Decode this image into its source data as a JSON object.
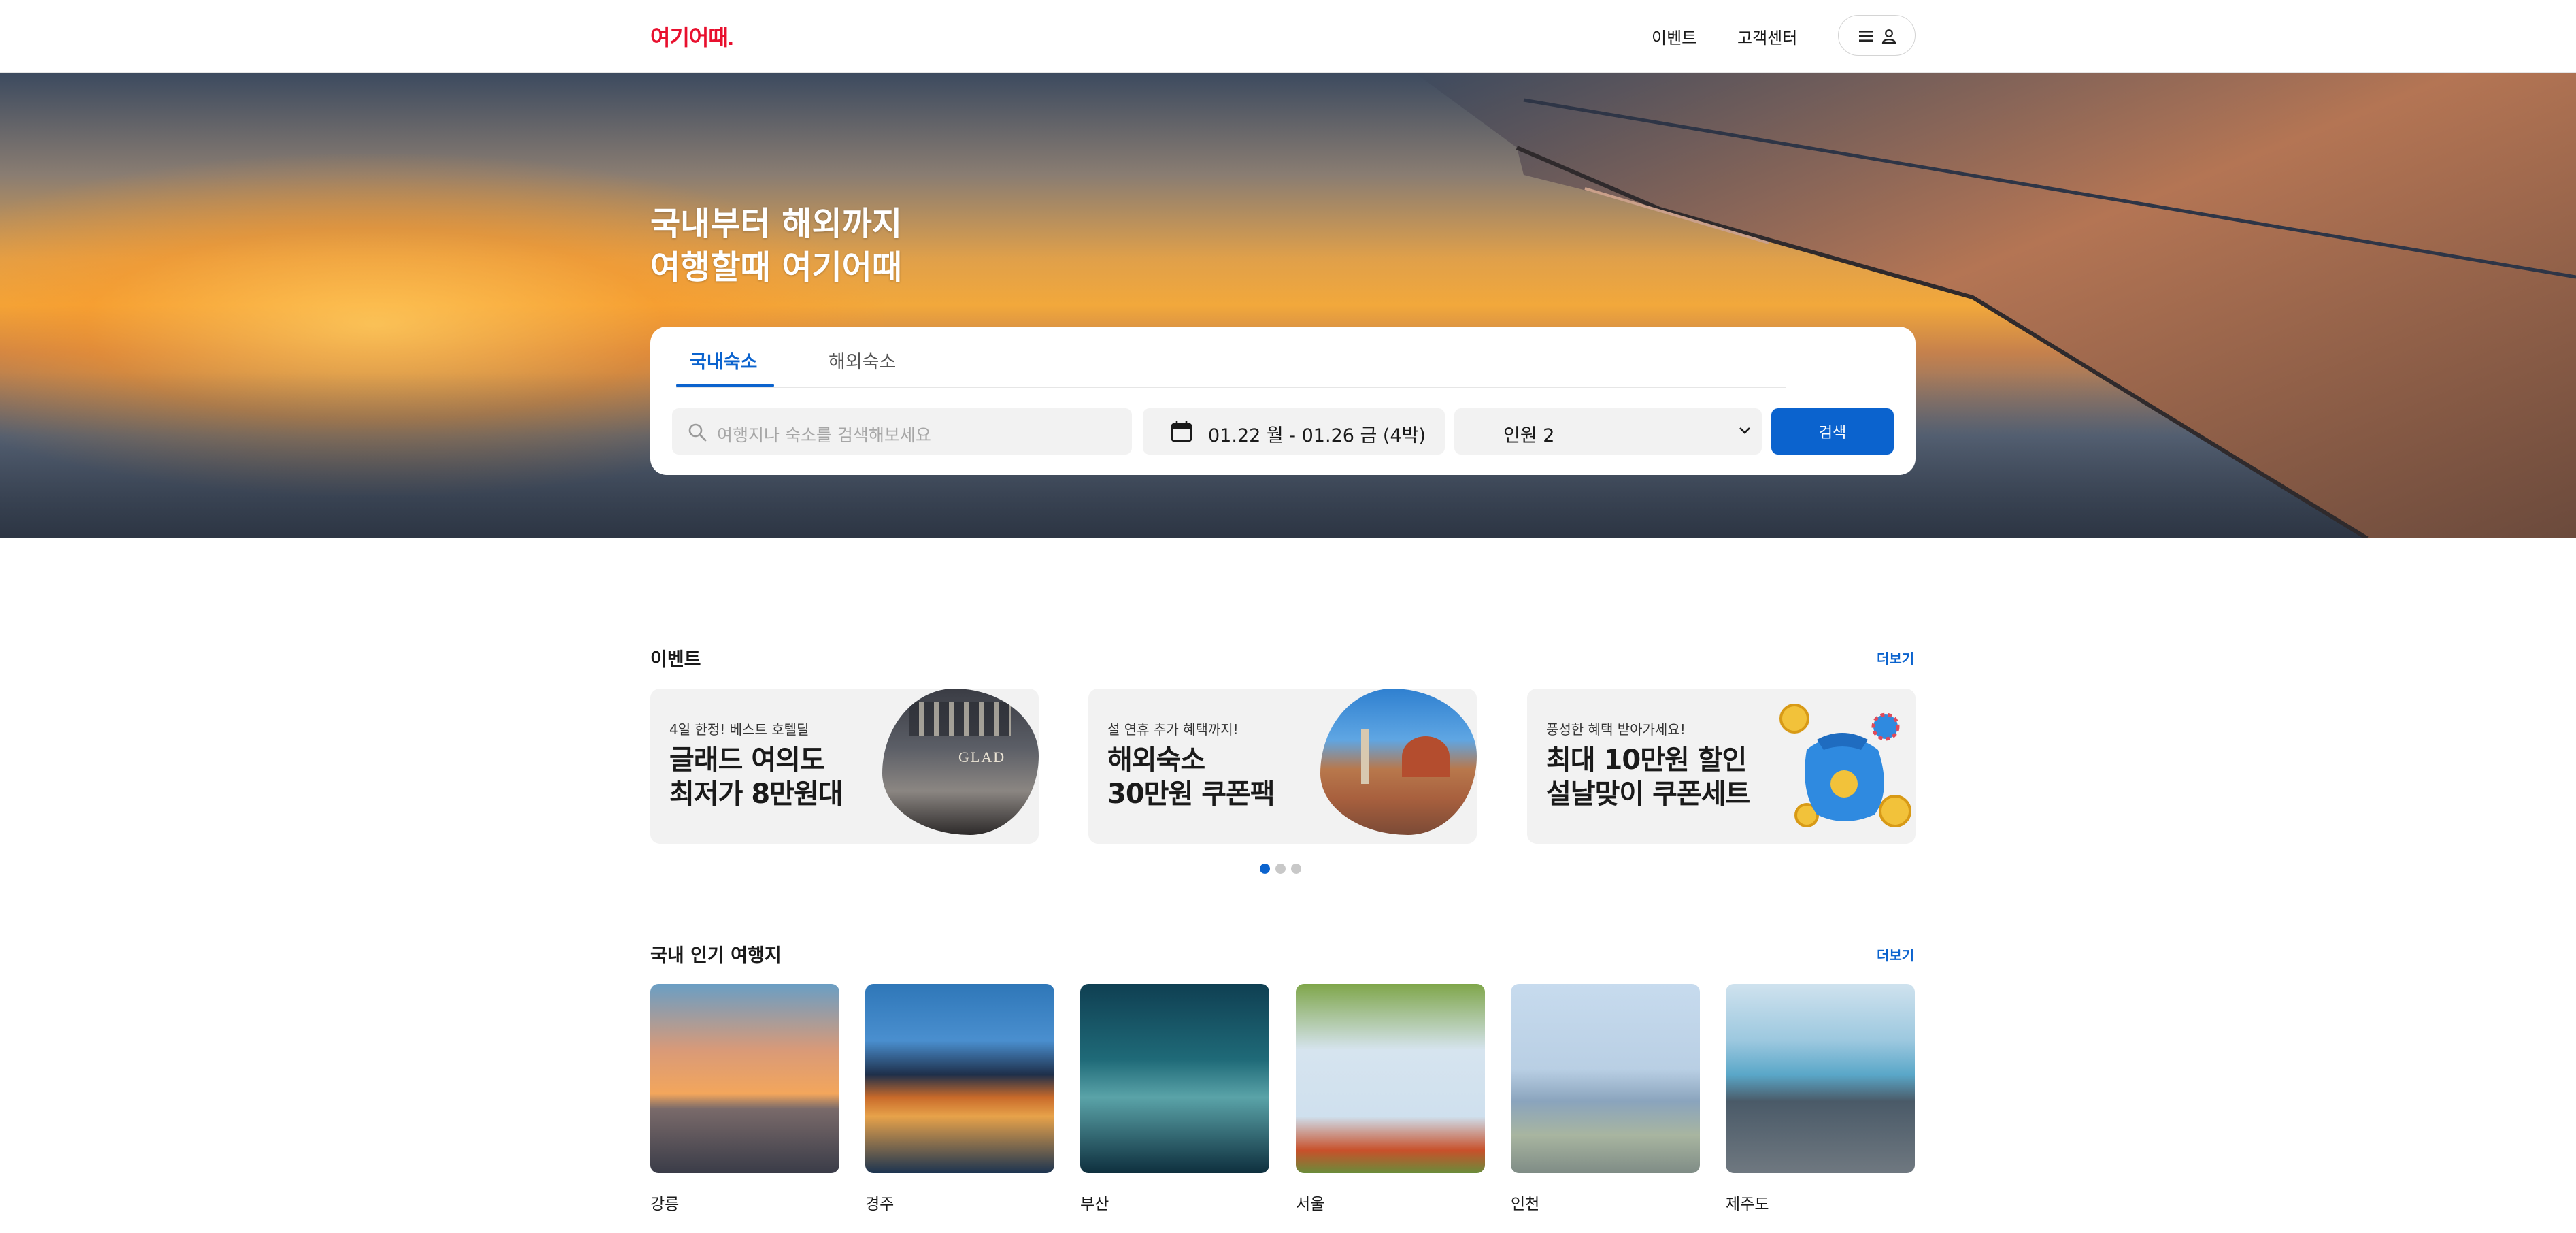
{
  "header": {
    "logo": "여기어때.",
    "nav": {
      "events": "이벤트",
      "support": "고객센터"
    },
    "icons": {
      "menu": "menu-icon",
      "user": "user-icon"
    }
  },
  "hero": {
    "title_line1": "국내부터 해외까지",
    "title_line2": "여행할때 여기어때"
  },
  "search": {
    "tabs": [
      {
        "label": "국내숙소",
        "selected": true
      },
      {
        "label": "해외숙소",
        "selected": false
      }
    ],
    "placeholder": "여행지나 숙소를 검색해보세요",
    "dates": "01.22 월 - 01.26 금 (4박)",
    "guests": "인원 2",
    "button": "검색"
  },
  "events": {
    "title": "이벤트",
    "more": "더보기",
    "cards": [
      {
        "sub": "4일 한정! 베스트 호텔딜",
        "line1": "글래드 여의도",
        "line2": "최저가 8만원대",
        "image_text": "GLAD"
      },
      {
        "sub": "설 연휴 추가 혜택까지!",
        "line1": "해외숙소",
        "line2": "30만원 쿠폰팩"
      },
      {
        "sub": "풍성한 혜택 받아가세요!",
        "line1": "최대 10만원 할인",
        "line2": "설날맞이 쿠폰세트"
      }
    ],
    "pages": 3,
    "current_page": 1
  },
  "popular": {
    "title": "국내 인기 여행지",
    "more": "더보기",
    "destinations": [
      {
        "name": "강릉"
      },
      {
        "name": "경주"
      },
      {
        "name": "부산"
      },
      {
        "name": "서울"
      },
      {
        "name": "인천"
      },
      {
        "name": "제주도"
      }
    ]
  },
  "colors": {
    "brand": "#e8102e",
    "accent": "#0b63ce"
  }
}
